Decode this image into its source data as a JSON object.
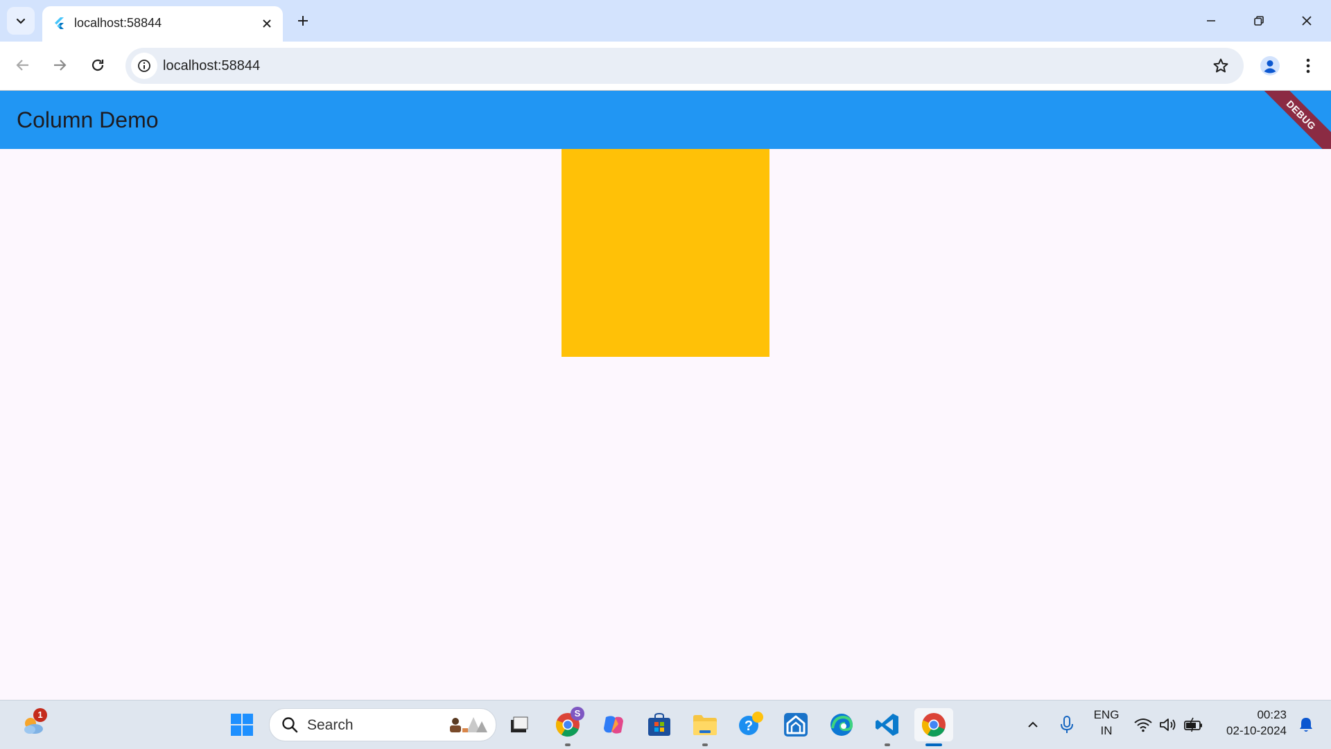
{
  "browser": {
    "tab_title": "localhost:58844",
    "url": "localhost:58844"
  },
  "app": {
    "title": "Column Demo",
    "debug_banner": "DEBUG",
    "appbar_color": "#2196f3",
    "background_color": "#fdf7fe",
    "box_color": "#ffc107"
  },
  "taskbar": {
    "search_label": "Search",
    "weather_badge": "1",
    "chrome_profile_badge": "S",
    "language_line1": "ENG",
    "language_line2": "IN",
    "time": "00:23",
    "date": "02-10-2024"
  }
}
